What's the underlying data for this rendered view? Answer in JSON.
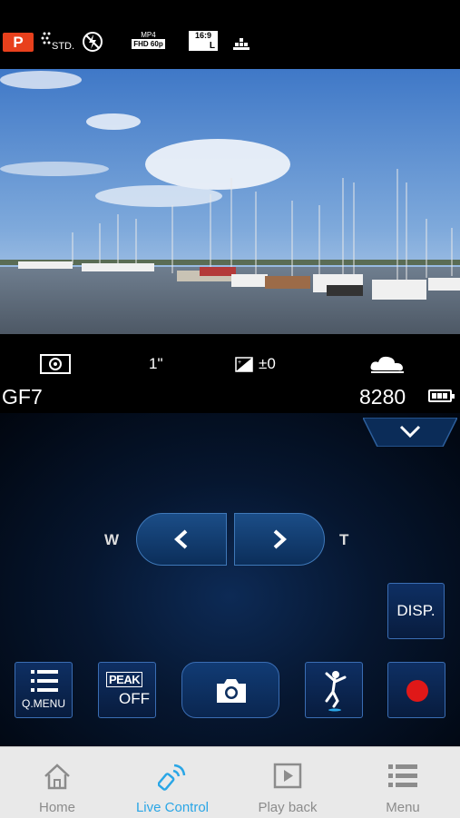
{
  "status_bar": {
    "mode": "P",
    "photo_style": "STD.",
    "movie_format": "MP4",
    "movie_quality": "FHD 60p",
    "aspect_ratio": "16:9",
    "size": "L"
  },
  "info_row": {
    "shutter_speed": "1\"",
    "exposure_comp": "±0"
  },
  "camera": {
    "model": "GF7",
    "shots_remaining": "8280"
  },
  "zoom": {
    "wide_label": "W",
    "tele_label": "T"
  },
  "controls": {
    "disp_label": "DISP.",
    "qmenu_label": "Q.MENU",
    "peak_label": "PEAK",
    "peak_value": "OFF"
  },
  "tabs": [
    {
      "label": "Home",
      "icon": "home-icon"
    },
    {
      "label": "Live Control",
      "icon": "wifi-remote-icon"
    },
    {
      "label": "Play back",
      "icon": "play-icon"
    },
    {
      "label": "Menu",
      "icon": "menu-icon"
    }
  ],
  "colors": {
    "accent": "#2aa6e6",
    "mode_badge": "#e8401c",
    "record": "#e01818"
  }
}
